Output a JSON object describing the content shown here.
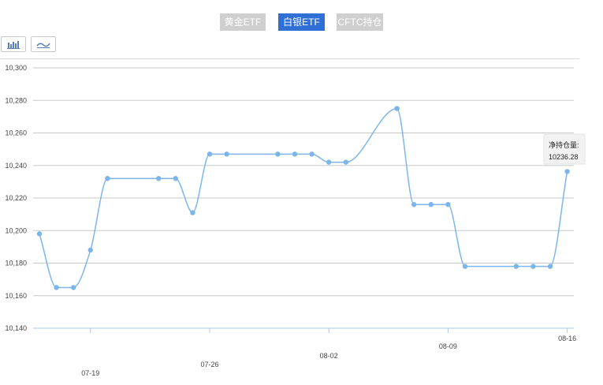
{
  "tabs": [
    {
      "label": "黄金ETF",
      "active": false
    },
    {
      "label": "白银ETF",
      "active": true
    },
    {
      "label": "CFTC持仓",
      "active": false
    }
  ],
  "toggles": {
    "bar_icon": "bar-chart-icon",
    "line_icon": "line-chart-icon"
  },
  "colors": {
    "line": "#7cb5ec",
    "active_tab": "#2f6fd6",
    "inactive_tab": "#cfcfcf",
    "grid": "#c8c8c8"
  },
  "tooltip": {
    "label": "净持仓量:",
    "value": "10236.28"
  },
  "chart_data": {
    "type": "line",
    "ylim": [
      10140,
      10300
    ],
    "yticks": [
      "10,140",
      "10,160",
      "10,180",
      "10,200",
      "10,220",
      "10,240",
      "10,260",
      "10,280",
      "10,300"
    ],
    "xticks": [
      {
        "label": "07-19",
        "index": 3
      },
      {
        "label": "07-26",
        "index": 10
      },
      {
        "label": "08-02",
        "index": 17
      },
      {
        "label": "08-09",
        "index": 24
      },
      {
        "label": "08-16",
        "index": 31
      }
    ],
    "series": [
      {
        "values": [
          {
            "i": 0,
            "v": 10198
          },
          {
            "i": 1,
            "v": 10165
          },
          {
            "i": 2,
            "v": 10165
          },
          {
            "i": 3,
            "v": 10188
          },
          {
            "i": 4,
            "v": 10232
          },
          {
            "i": 7,
            "v": 10232
          },
          {
            "i": 8,
            "v": 10232
          },
          {
            "i": 9,
            "v": 10211
          },
          {
            "i": 10,
            "v": 10247
          },
          {
            "i": 11,
            "v": 10247
          },
          {
            "i": 14,
            "v": 10247
          },
          {
            "i": 15,
            "v": 10247
          },
          {
            "i": 16,
            "v": 10247
          },
          {
            "i": 17,
            "v": 10242
          },
          {
            "i": 18,
            "v": 10242
          },
          {
            "i": 21,
            "v": 10275
          },
          {
            "i": 22,
            "v": 10216
          },
          {
            "i": 23,
            "v": 10216
          },
          {
            "i": 24,
            "v": 10216
          },
          {
            "i": 25,
            "v": 10178
          },
          {
            "i": 28,
            "v": 10178
          },
          {
            "i": 29,
            "v": 10178
          },
          {
            "i": 30,
            "v": 10178
          },
          {
            "i": 31,
            "v": 10236.28
          }
        ]
      }
    ]
  }
}
